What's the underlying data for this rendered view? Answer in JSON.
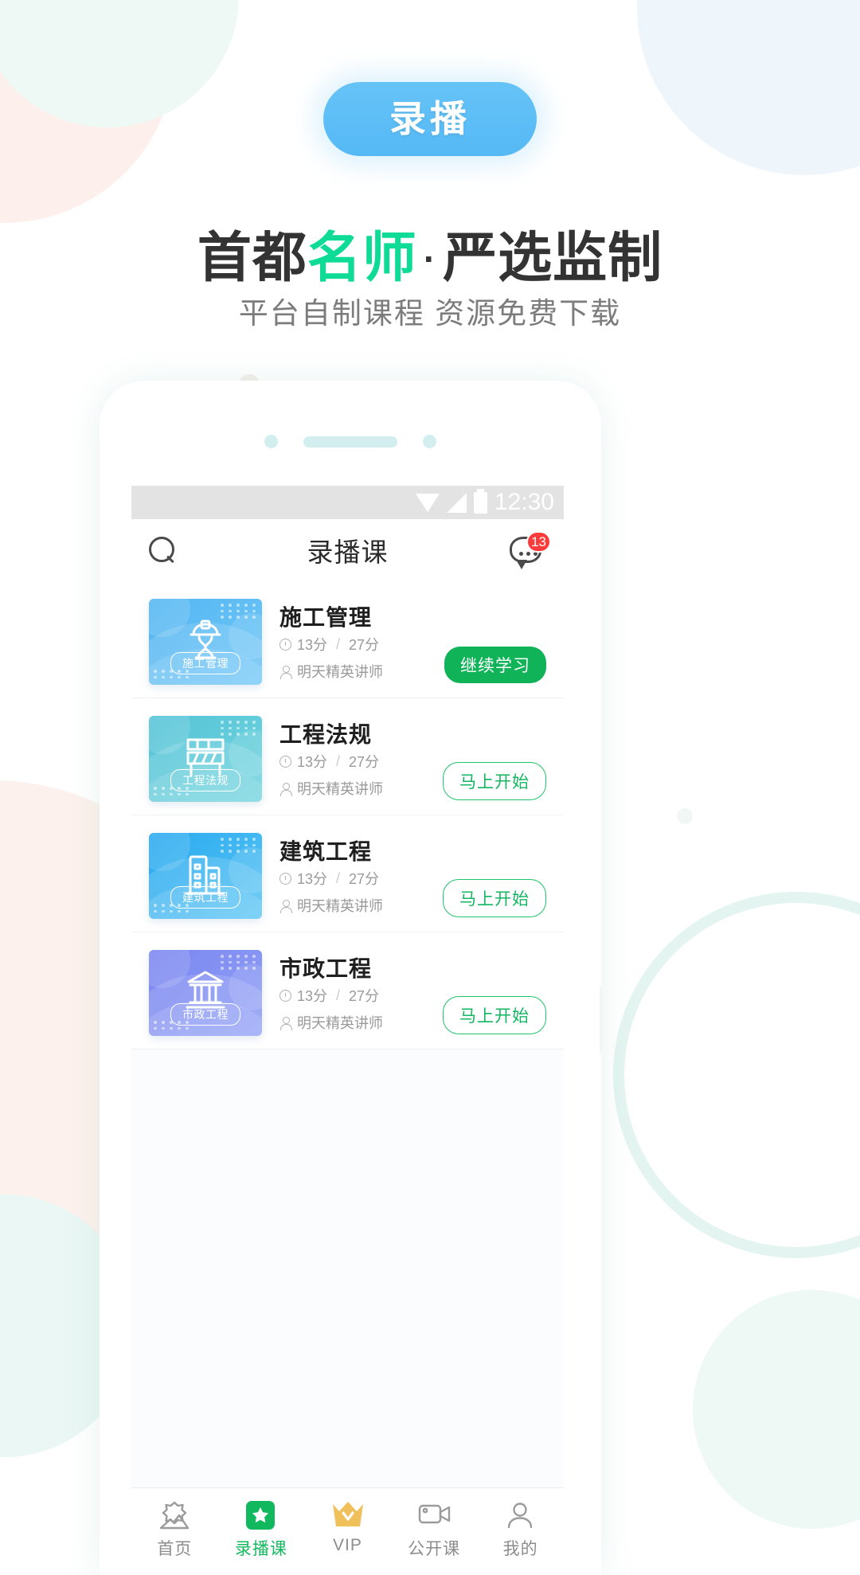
{
  "promo": {
    "badge_label": "录播",
    "headline_prefix": "首都",
    "headline_accent": "名师",
    "headline_dot": "·",
    "headline_suffix": "严选监制",
    "subline": "平台自制课程 资源免费下载",
    "accent_color": "#0ddb96",
    "badge_color": "#5bbdf6"
  },
  "phone": {
    "statusbar": {
      "time": "12:30",
      "icons": [
        "wifi-icon",
        "signal-icon",
        "battery-icon"
      ]
    },
    "appbar": {
      "search_icon": "search-icon",
      "title": "录播课",
      "chat_icon": "chat-bubble-icon",
      "badge_count": "13",
      "badge_color": "#fb3b3b"
    },
    "courses": [
      {
        "title": "施工管理",
        "thumb_tag": "施工管理",
        "thumb_icon": "worker-helmet-icon",
        "thumb_from": "#54b6f2",
        "thumb_to": "#6ec6f7",
        "watched": "13分",
        "separator": "/",
        "total": "27分",
        "teacher": "明天精英讲师",
        "action_label": "继续学习",
        "action_style": "filled"
      },
      {
        "title": "工程法规",
        "thumb_tag": "工程法规",
        "thumb_icon": "barrier-icon",
        "thumb_from": "#55c3d6",
        "thumb_to": "#6fd4df",
        "watched": "13分",
        "separator": "/",
        "total": "27分",
        "teacher": "明天精英讲师",
        "action_label": "马上开始",
        "action_style": "outline"
      },
      {
        "title": "建筑工程",
        "thumb_tag": "建筑工程",
        "thumb_icon": "building-icon",
        "thumb_from": "#29a9ef",
        "thumb_to": "#57c4f4",
        "watched": "13分",
        "separator": "/",
        "total": "27分",
        "teacher": "明天精英讲师",
        "action_label": "马上开始",
        "action_style": "outline"
      },
      {
        "title": "市政工程",
        "thumb_tag": "市政工程",
        "thumb_icon": "bank-columns-icon",
        "thumb_from": "#7b86f0",
        "thumb_to": "#8fa0f6",
        "watched": "13分",
        "separator": "/",
        "total": "27分",
        "teacher": "明天精英讲师",
        "action_label": "马上开始",
        "action_style": "outline"
      }
    ],
    "tabs": [
      {
        "label": "首页",
        "icon": "home-mountain-icon",
        "active": false
      },
      {
        "label": "录播课",
        "icon": "star-square-icon",
        "active": true
      },
      {
        "label": "VIP",
        "icon": "crown-icon",
        "active": false
      },
      {
        "label": "公开课",
        "icon": "video-camera-icon",
        "active": false
      },
      {
        "label": "我的",
        "icon": "person-icon",
        "active": false
      }
    ]
  }
}
